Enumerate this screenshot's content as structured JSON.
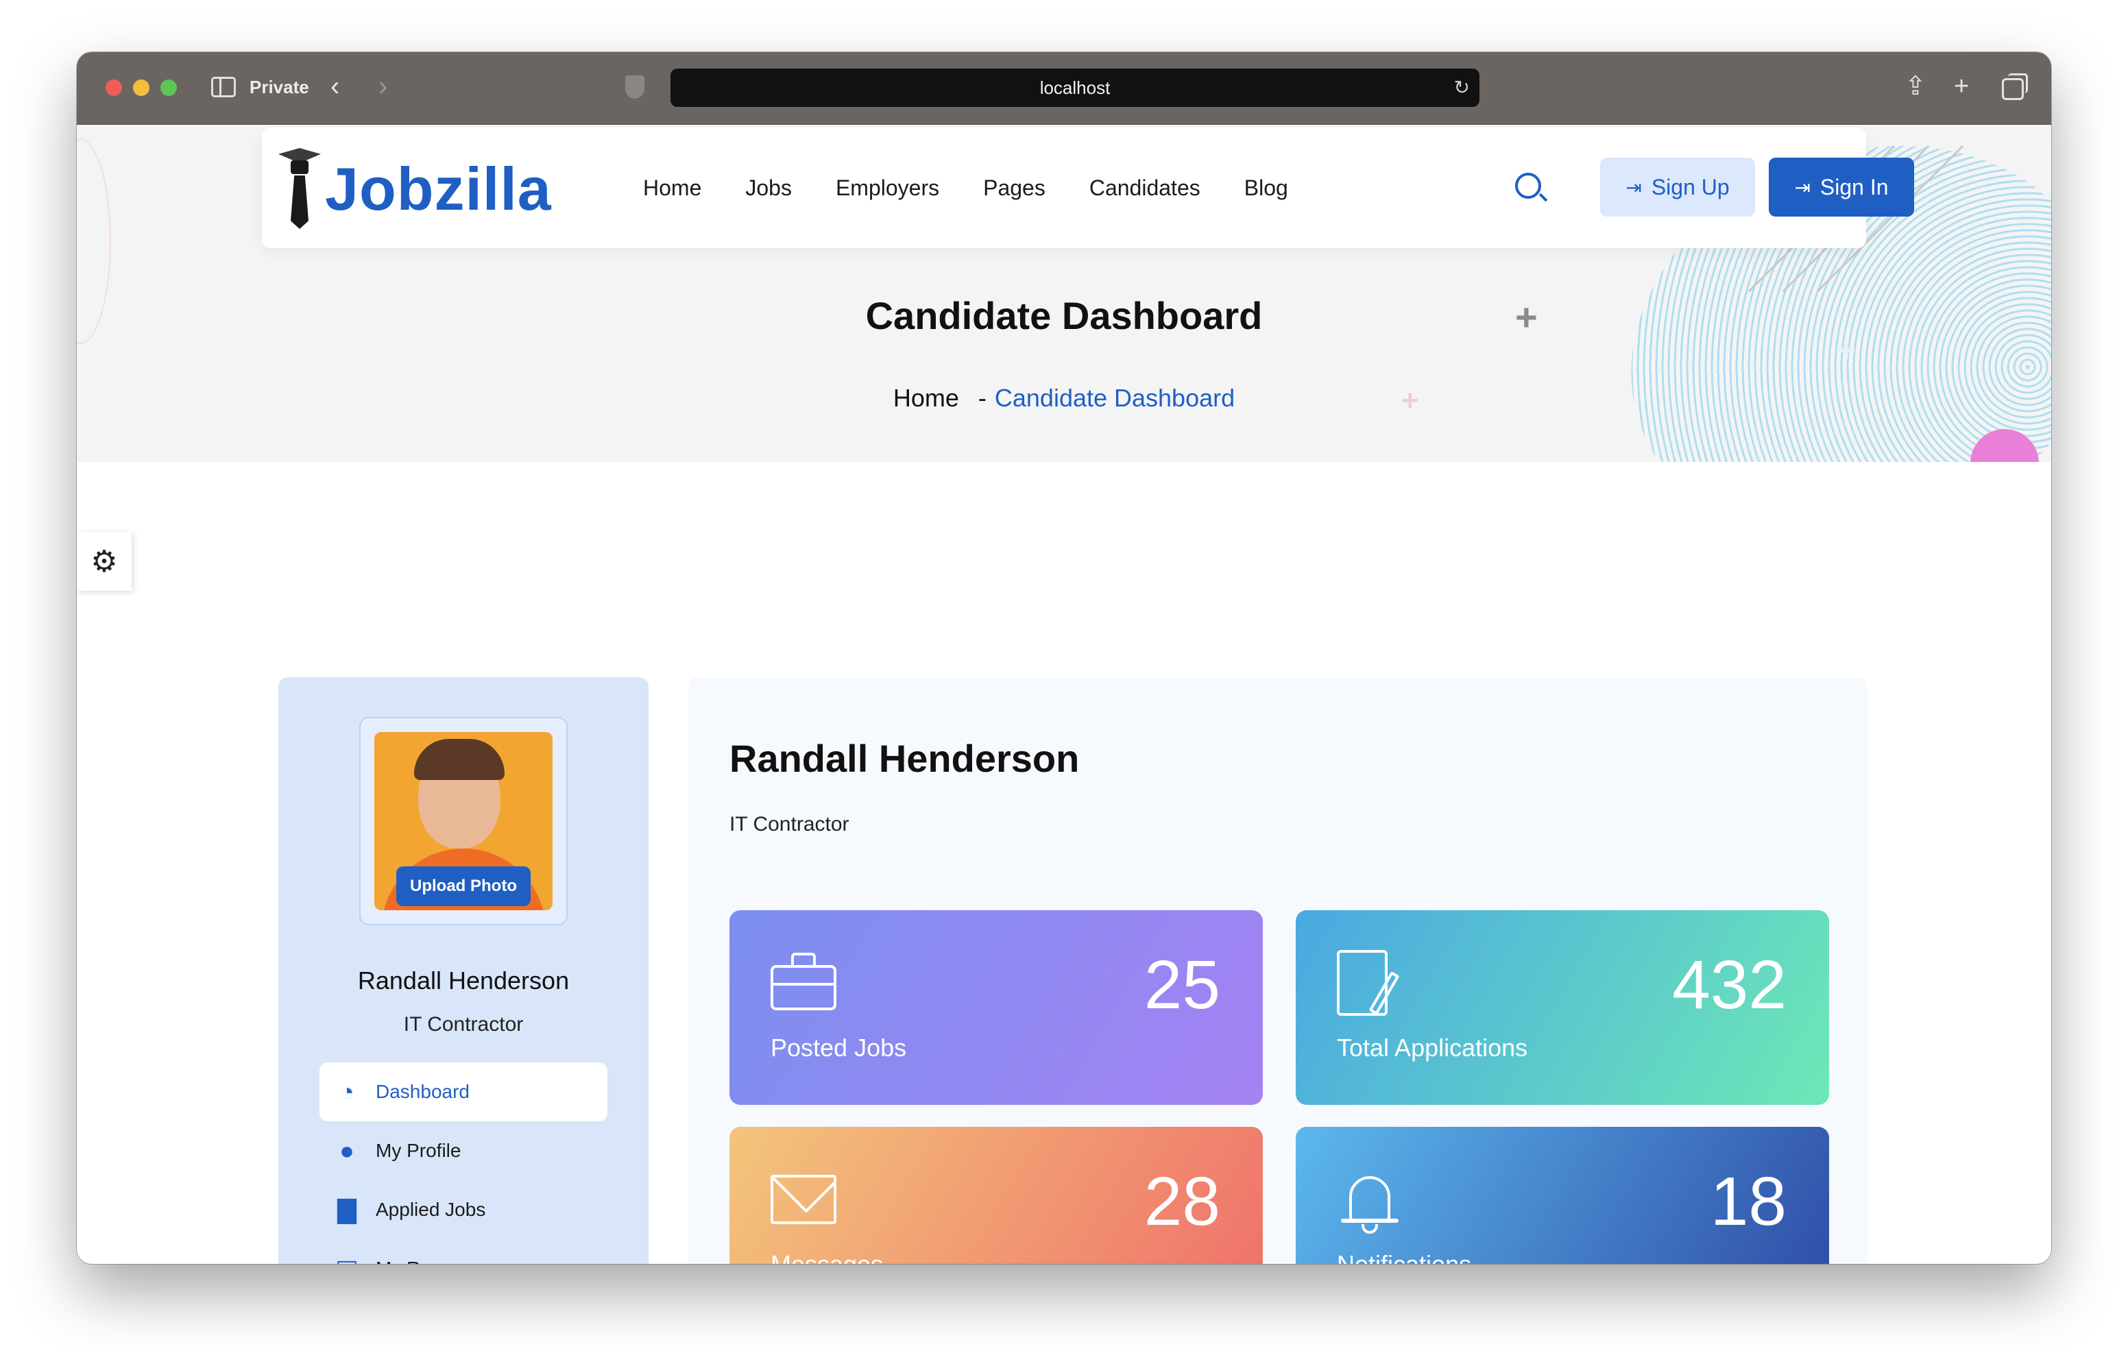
{
  "browser": {
    "private_label": "Private",
    "url": "localhost"
  },
  "site": {
    "logo_text": "Jobzilla",
    "nav": [
      "Home",
      "Jobs",
      "Employers",
      "Pages",
      "Candidates",
      "Blog"
    ],
    "sign_up_label": "Sign Up",
    "sign_in_label": "Sign In",
    "accent_color": "#1f5fc4"
  },
  "hero": {
    "title": "Candidate Dashboard",
    "breadcrumb_home": "Home",
    "breadcrumb_separator": "-",
    "breadcrumb_current": "Candidate Dashboard"
  },
  "profile": {
    "upload_photo_label": "Upload Photo",
    "name": "Randall Henderson",
    "role": "IT Contractor",
    "menu": [
      {
        "label": "Dashboard",
        "icon": "speedometer-icon",
        "active": true
      },
      {
        "label": "My Profile",
        "icon": "user-icon",
        "active": false
      },
      {
        "label": "Applied Jobs",
        "icon": "briefcase-icon",
        "active": false
      },
      {
        "label": "My Resume",
        "icon": "receipt-icon",
        "active": false
      }
    ]
  },
  "dashboard": {
    "name": "Randall Henderson",
    "role": "IT Contractor",
    "stats": [
      {
        "label": "Posted Jobs",
        "value": "25",
        "icon": "briefcase-icon"
      },
      {
        "label": "Total Applications",
        "value": "432",
        "icon": "resume-edit-icon"
      },
      {
        "label": "Messages",
        "value": "28",
        "icon": "envelope-icon"
      },
      {
        "label": "Notifications",
        "value": "18",
        "icon": "bell-icon"
      }
    ]
  }
}
